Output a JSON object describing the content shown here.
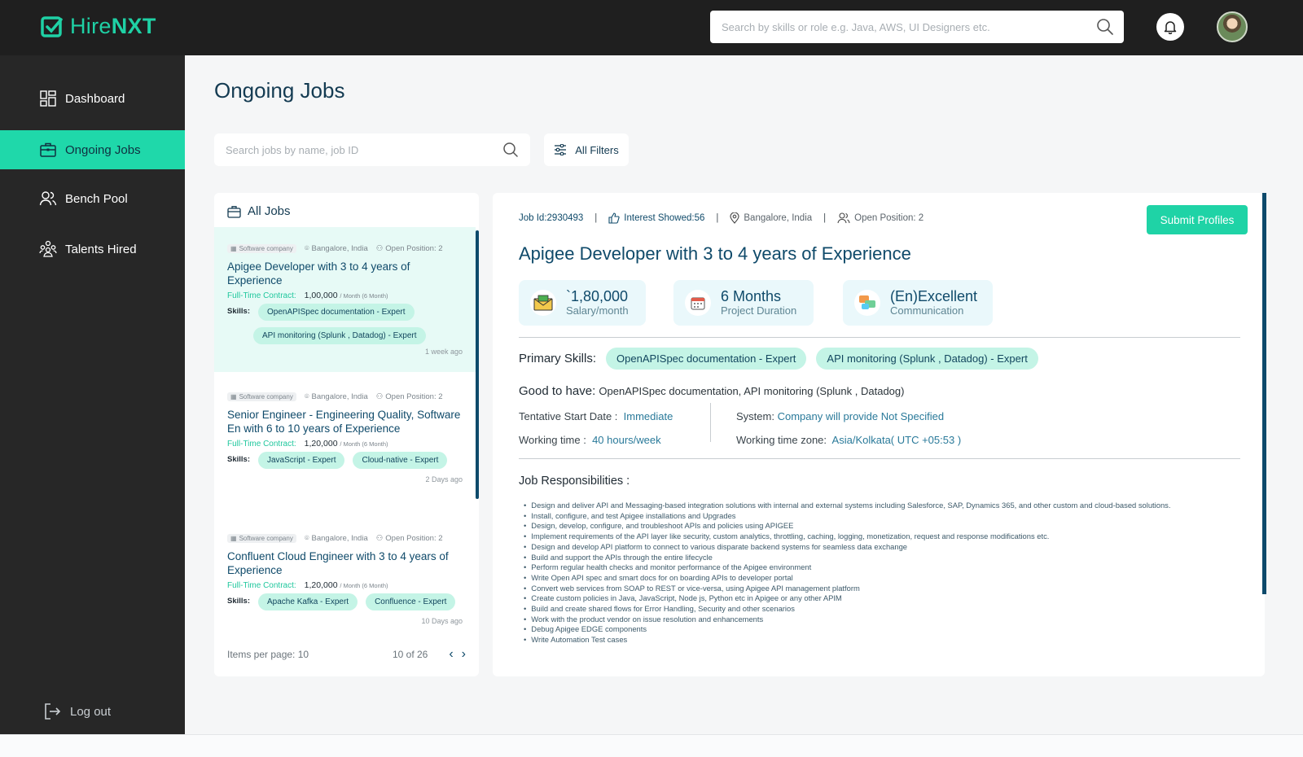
{
  "header": {
    "logo_prefix": "Hire",
    "logo_suffix": "NXT",
    "search_placeholder": "Search by skills or role e.g. Java, AWS, UI Designers etc."
  },
  "sidebar": {
    "items": [
      {
        "label": "Dashboard",
        "icon": "dashboard-icon",
        "active": false
      },
      {
        "label": "Ongoing Jobs",
        "icon": "briefcase-icon",
        "active": true
      },
      {
        "label": "Bench Pool",
        "icon": "users-icon",
        "active": false
      },
      {
        "label": "Talents Hired",
        "icon": "team-icon",
        "active": false
      }
    ],
    "logout_label": "Log out"
  },
  "main": {
    "title": "Ongoing Jobs",
    "job_search_placeholder": "Search jobs by name, job ID",
    "filters_label": "All Filters"
  },
  "job_list": {
    "heading": "All Jobs",
    "skills_label": "Skills:",
    "contract_label": "Full-Time Contract:",
    "jobs": [
      {
        "company": "Software company",
        "location": "Bangalore, India",
        "positions": "Open Position: 2",
        "title": "Apigee Developer with 3 to 4 years of Experience",
        "salary": "1,00,000",
        "unit": "/ Month (6 Month)",
        "skills": [
          "OpenAPISpec documentation - Expert",
          "API monitoring (Splunk , Datadog) - Expert"
        ],
        "ago": "1 week ago"
      },
      {
        "company": "Software company",
        "location": "Bangalore, India",
        "positions": "Open Position: 2",
        "title": "Senior Engineer - Engineering Quality, Software En with 6 to 10 years of Experience",
        "salary": "1,20,000",
        "unit": "/ Month (6 Month)",
        "skills": [
          "JavaScript - Expert",
          "Cloud-native - Expert"
        ],
        "ago": "2 Days ago"
      },
      {
        "company": "Software company",
        "location": "Bangalore, India",
        "positions": "Open Position: 2",
        "title": "Confluent Cloud Engineer with 3 to 4 years of Experience",
        "salary": "1,20,000",
        "unit": "/ Month (6 Month)",
        "skills": [
          "Apache Kafka - Expert",
          "Confluence - Expert"
        ],
        "ago": "10 Days ago"
      }
    ],
    "pager": {
      "items_per_page": "Items per page: 10",
      "count": "10 of 26",
      "prev": "‹",
      "next": "›"
    }
  },
  "detail": {
    "job_id": "Job Id:2930493",
    "interest": "Interest Showed:56",
    "location": "Bangalore, India",
    "positions": "Open Position: 2",
    "submit_label": "Submit Profiles",
    "title": "Apigee Developer with 3 to 4 years of Experience",
    "stats": [
      {
        "value": "`1,80,000",
        "label": "Salary/month",
        "icon": "salary-icon"
      },
      {
        "value": "6 Months",
        "label": "Project Duration",
        "icon": "calendar-icon"
      },
      {
        "value": "(En)Excellent",
        "label": "Communication",
        "icon": "chat-icon"
      }
    ],
    "primary_skills_label": "Primary Skills:",
    "primary_skills": [
      "OpenAPISpec documentation - Expert",
      "API monitoring (Splunk , Datadog) - Expert"
    ],
    "good_to_have_label": "Good to have:",
    "good_to_have": "OpenAPISpec documentation, API monitoring (Splunk , Datadog)",
    "start_date_label": "Tentative Start Date :",
    "start_date": "Immediate",
    "working_time_label": "Working time :",
    "working_time": "40 hours/week",
    "system_label": "System:",
    "system": "Company will provide Not Specified",
    "timezone_label": "Working time zone:",
    "timezone": "Asia/Kolkata( UTC +05:53 )",
    "responsibilities_heading": "Job Responsibilities :",
    "responsibilities": [
      "Design and deliver API and Messaging-based integration solutions with internal and external systems including Salesforce, SAP, Dynamics 365, and other custom and cloud-based solutions.",
      "Install, configure, and test Apigee installations and Upgrades",
      "Design, develop, configure, and troubleshoot APIs and policies using APIGEE",
      "Implement requirements of the API layer like security, custom analytics, throttling, caching, logging, monetization, request and response modifications etc.",
      "Design and develop API platform to connect to various disparate backend systems for seamless data exchange",
      "Build and support the APIs through the entire lifecycle",
      "Perform regular health checks and monitor performance of the Apigee environment",
      "Write Open API spec and smart docs for on boarding APIs to developer portal",
      "Convert web services from SOAP to REST or vice-versa, using Apigee API management platform",
      "Create custom policies in Java, JavaScript, Node js, Python etc in Apigee or any other APIM",
      "Build and create shared flows for Error Handling, Security and other scenarios",
      "Work with the product vendor on issue resolution and enhancements",
      "Debug Apigee EDGE components",
      "Write Automation Test cases"
    ]
  },
  "colors": {
    "accent": "#1fd8aa",
    "topbar": "#1f1f1f",
    "sidebar": "#272727",
    "title": "#0f4a6a"
  }
}
